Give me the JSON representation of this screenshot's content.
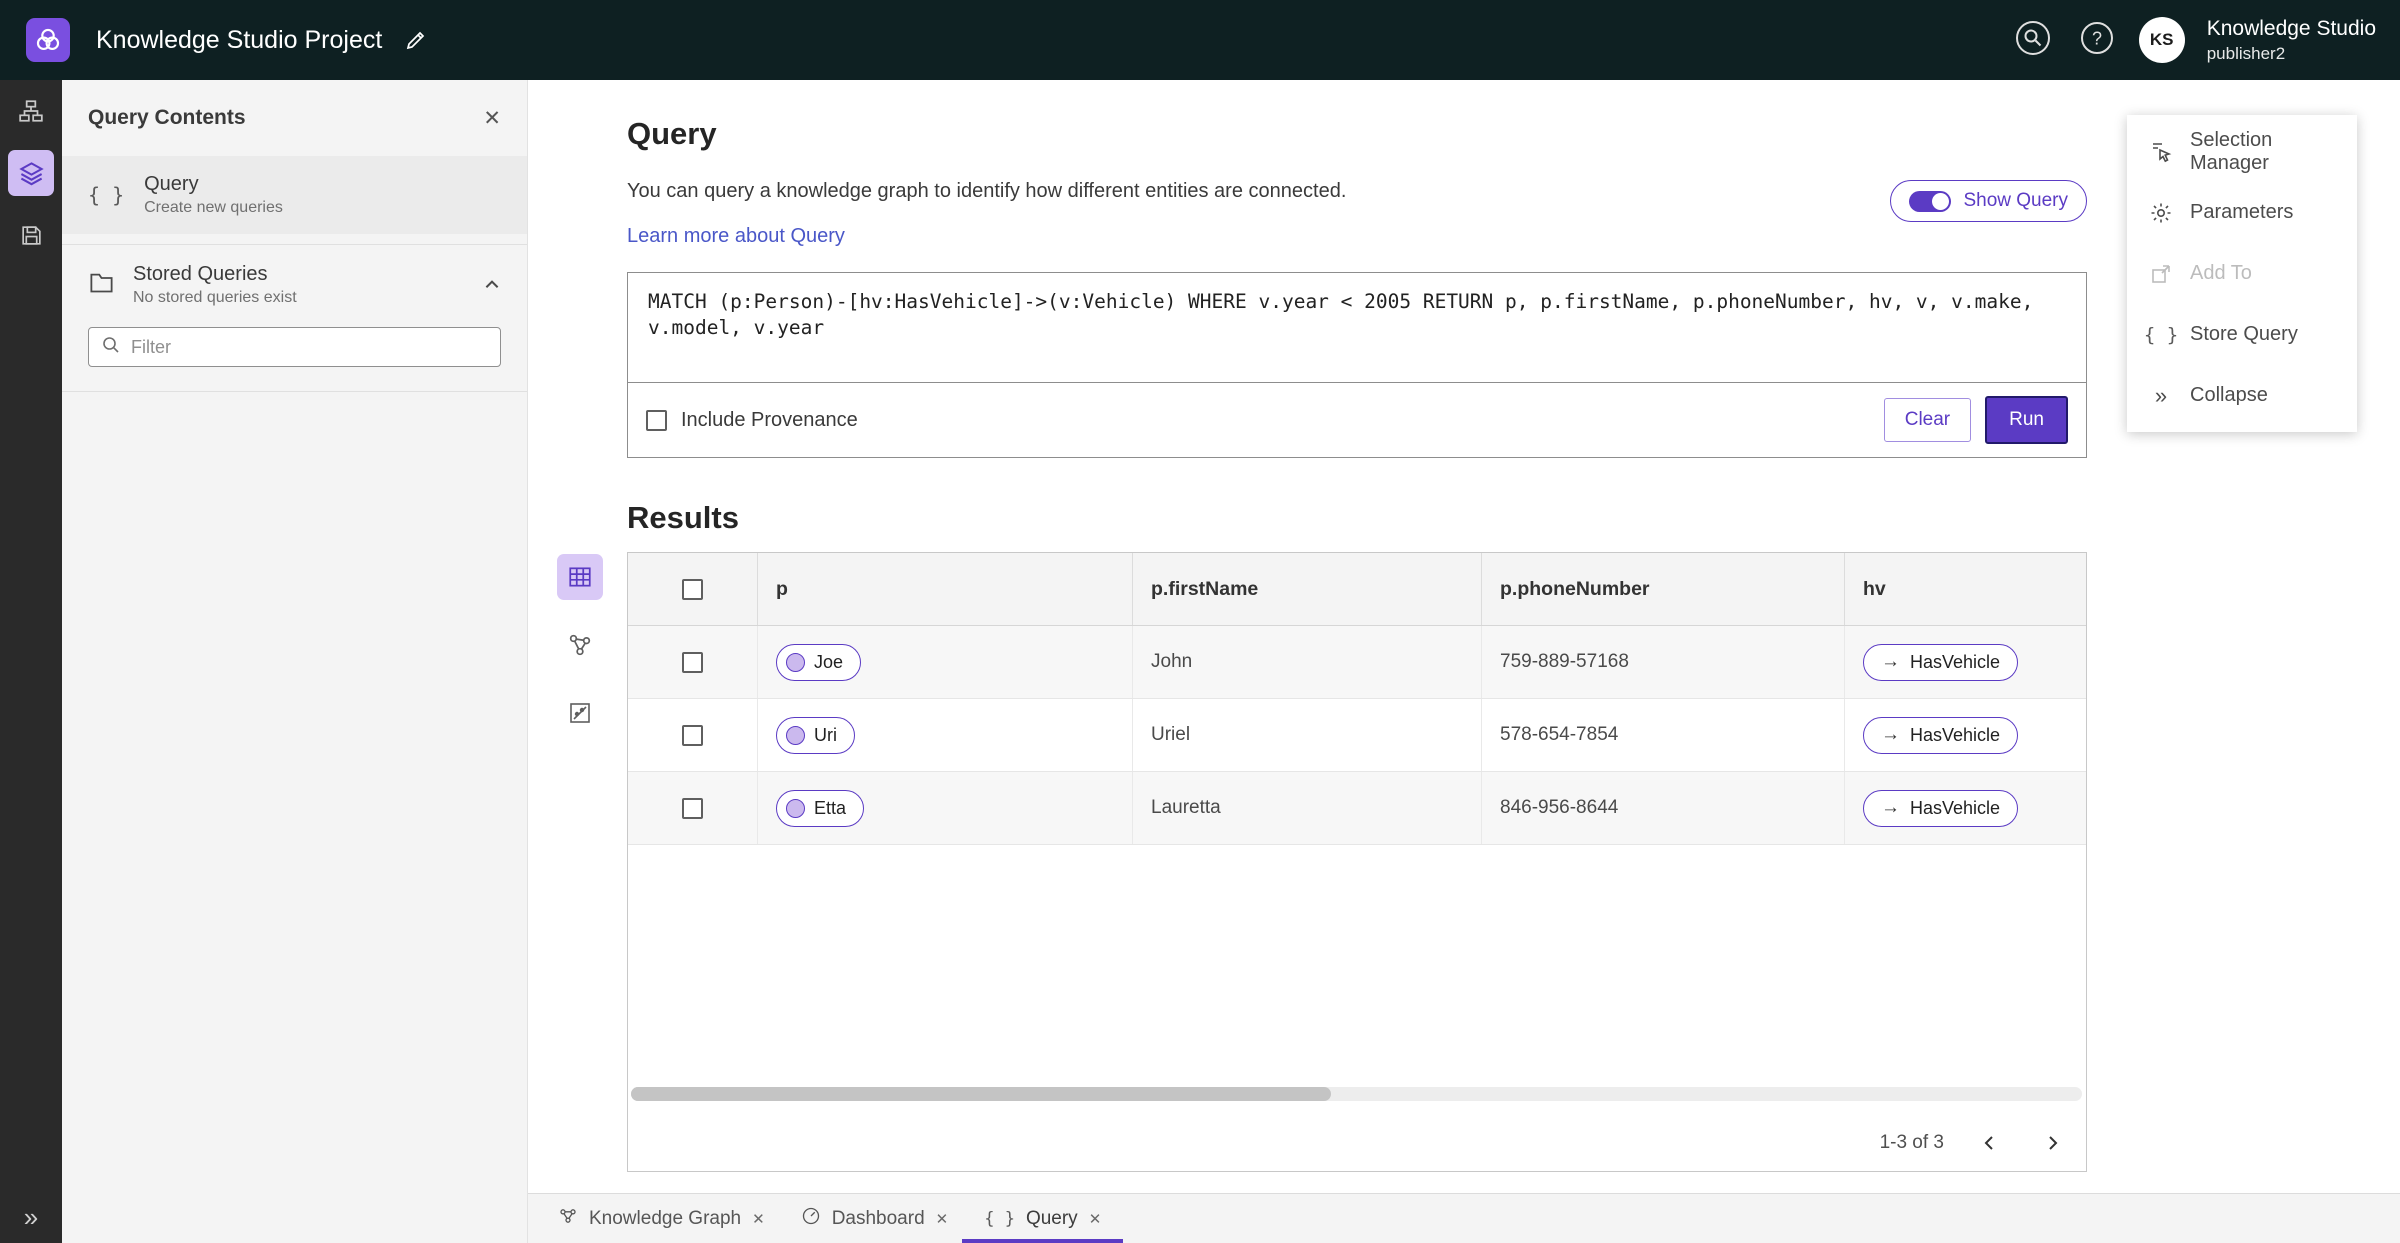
{
  "topbar": {
    "title": "Knowledge Studio Project",
    "avatar_initials": "KS",
    "user_name": "Knowledge Studio",
    "user_sub": "publisher2"
  },
  "sidebar": {
    "title": "Query Contents",
    "query_item": {
      "label": "Query",
      "sublabel": "Create new queries"
    },
    "stored": {
      "label": "Stored Queries",
      "sublabel": "No stored queries exist"
    },
    "filter_placeholder": "Filter"
  },
  "query": {
    "heading": "Query",
    "description": "You can query a knowledge graph to identify how different entities are connected.",
    "learn_more": "Learn more about Query",
    "show_query_label": "Show Query",
    "query_text": "MATCH (p:Person)-[hv:HasVehicle]->(v:Vehicle) WHERE v.year < 2005 RETURN p, p.firstName, p.phoneNumber, hv, v, v.make, v.model, v.year",
    "include_provenance": "Include Provenance",
    "clear_label": "Clear",
    "run_label": "Run"
  },
  "results": {
    "heading": "Results",
    "columns": [
      "p",
      "p.firstName",
      "p.phoneNumber",
      "hv"
    ],
    "rows": [
      {
        "p": "Joe",
        "firstName": "John",
        "phoneNumber": "759-889-57168",
        "hv": "HasVehicle"
      },
      {
        "p": "Uri",
        "firstName": "Uriel",
        "phoneNumber": "578-654-7854",
        "hv": "HasVehicle"
      },
      {
        "p": "Etta",
        "firstName": "Lauretta",
        "phoneNumber": "846-956-8644",
        "hv": "HasVehicle"
      }
    ],
    "pagination": "1-3 of 3"
  },
  "context_menu": {
    "items": [
      {
        "label": "Selection Manager"
      },
      {
        "label": "Parameters"
      },
      {
        "label": "Add To"
      },
      {
        "label": "Store Query"
      },
      {
        "label": "Collapse"
      }
    ]
  },
  "tabs": [
    {
      "label": "Knowledge Graph"
    },
    {
      "label": "Dashboard"
    },
    {
      "label": "Query"
    }
  ],
  "colors": {
    "accent": "#5b3bc4",
    "topbar": "#0e2022",
    "link": "#4a57c8"
  }
}
